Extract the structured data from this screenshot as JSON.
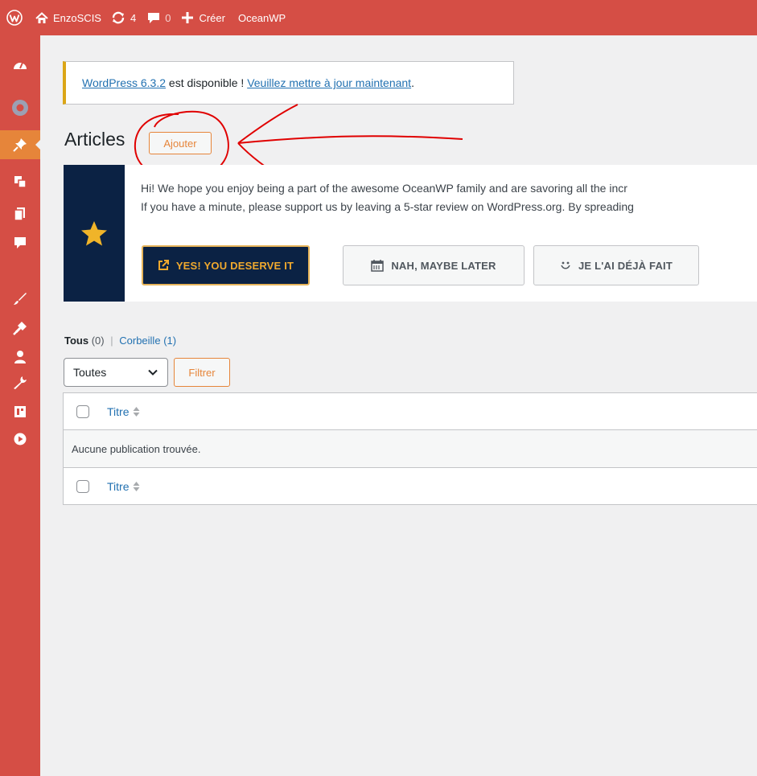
{
  "adminbar": {
    "site_name": "EnzoSCIS",
    "updates_count": "4",
    "comments_count": "0",
    "new_label": "Créer",
    "theme_link": "OceanWP"
  },
  "sidebar": {
    "items": [
      {
        "icon": "dashboard-icon"
      },
      {
        "icon": "oceanwp-icon"
      },
      {
        "icon": "pin-icon",
        "current": true
      },
      {
        "icon": "media-icon"
      },
      {
        "icon": "pages-icon"
      },
      {
        "icon": "comments-icon"
      },
      {
        "icon": "appearance-icon"
      },
      {
        "icon": "plugins-icon"
      },
      {
        "icon": "users-icon"
      },
      {
        "icon": "tools-icon"
      },
      {
        "icon": "settings-icon"
      },
      {
        "icon": "play-icon"
      }
    ]
  },
  "notice": {
    "link_version": "WordPress 6.3.2",
    "text": " est disponible ! ",
    "link_update": "Veuillez mettre à jour maintenant",
    "end": "."
  },
  "page": {
    "title": "Articles",
    "add_button": "Ajouter"
  },
  "review": {
    "line1": "Hi! We hope you enjoy being a part of the awesome OceanWP family and are savoring all the incr",
    "line2": "If you have a minute, please support us by leaving a 5-star review on WordPress.org. By spreading",
    "btn_yes": "YES! YOU DESERVE IT",
    "btn_later": "NAH, MAYBE LATER",
    "btn_done": "JE L'AI DÉJÀ FAIT"
  },
  "views": {
    "all_label": "Tous",
    "all_count": "(0)",
    "separator": "|",
    "trash_label": "Corbeille",
    "trash_count": "(1)"
  },
  "filters": {
    "date_select": "Toutes",
    "filter_button": "Filtrer"
  },
  "table": {
    "column_title": "Titre",
    "empty_message": "Aucune publication trouvée."
  },
  "colors": {
    "adminbar": "#d54e45",
    "accent": "#e6853a",
    "link": "#2271b1",
    "review_dark": "#0b2244",
    "star": "#f0b429",
    "annotation": "#e00000"
  }
}
